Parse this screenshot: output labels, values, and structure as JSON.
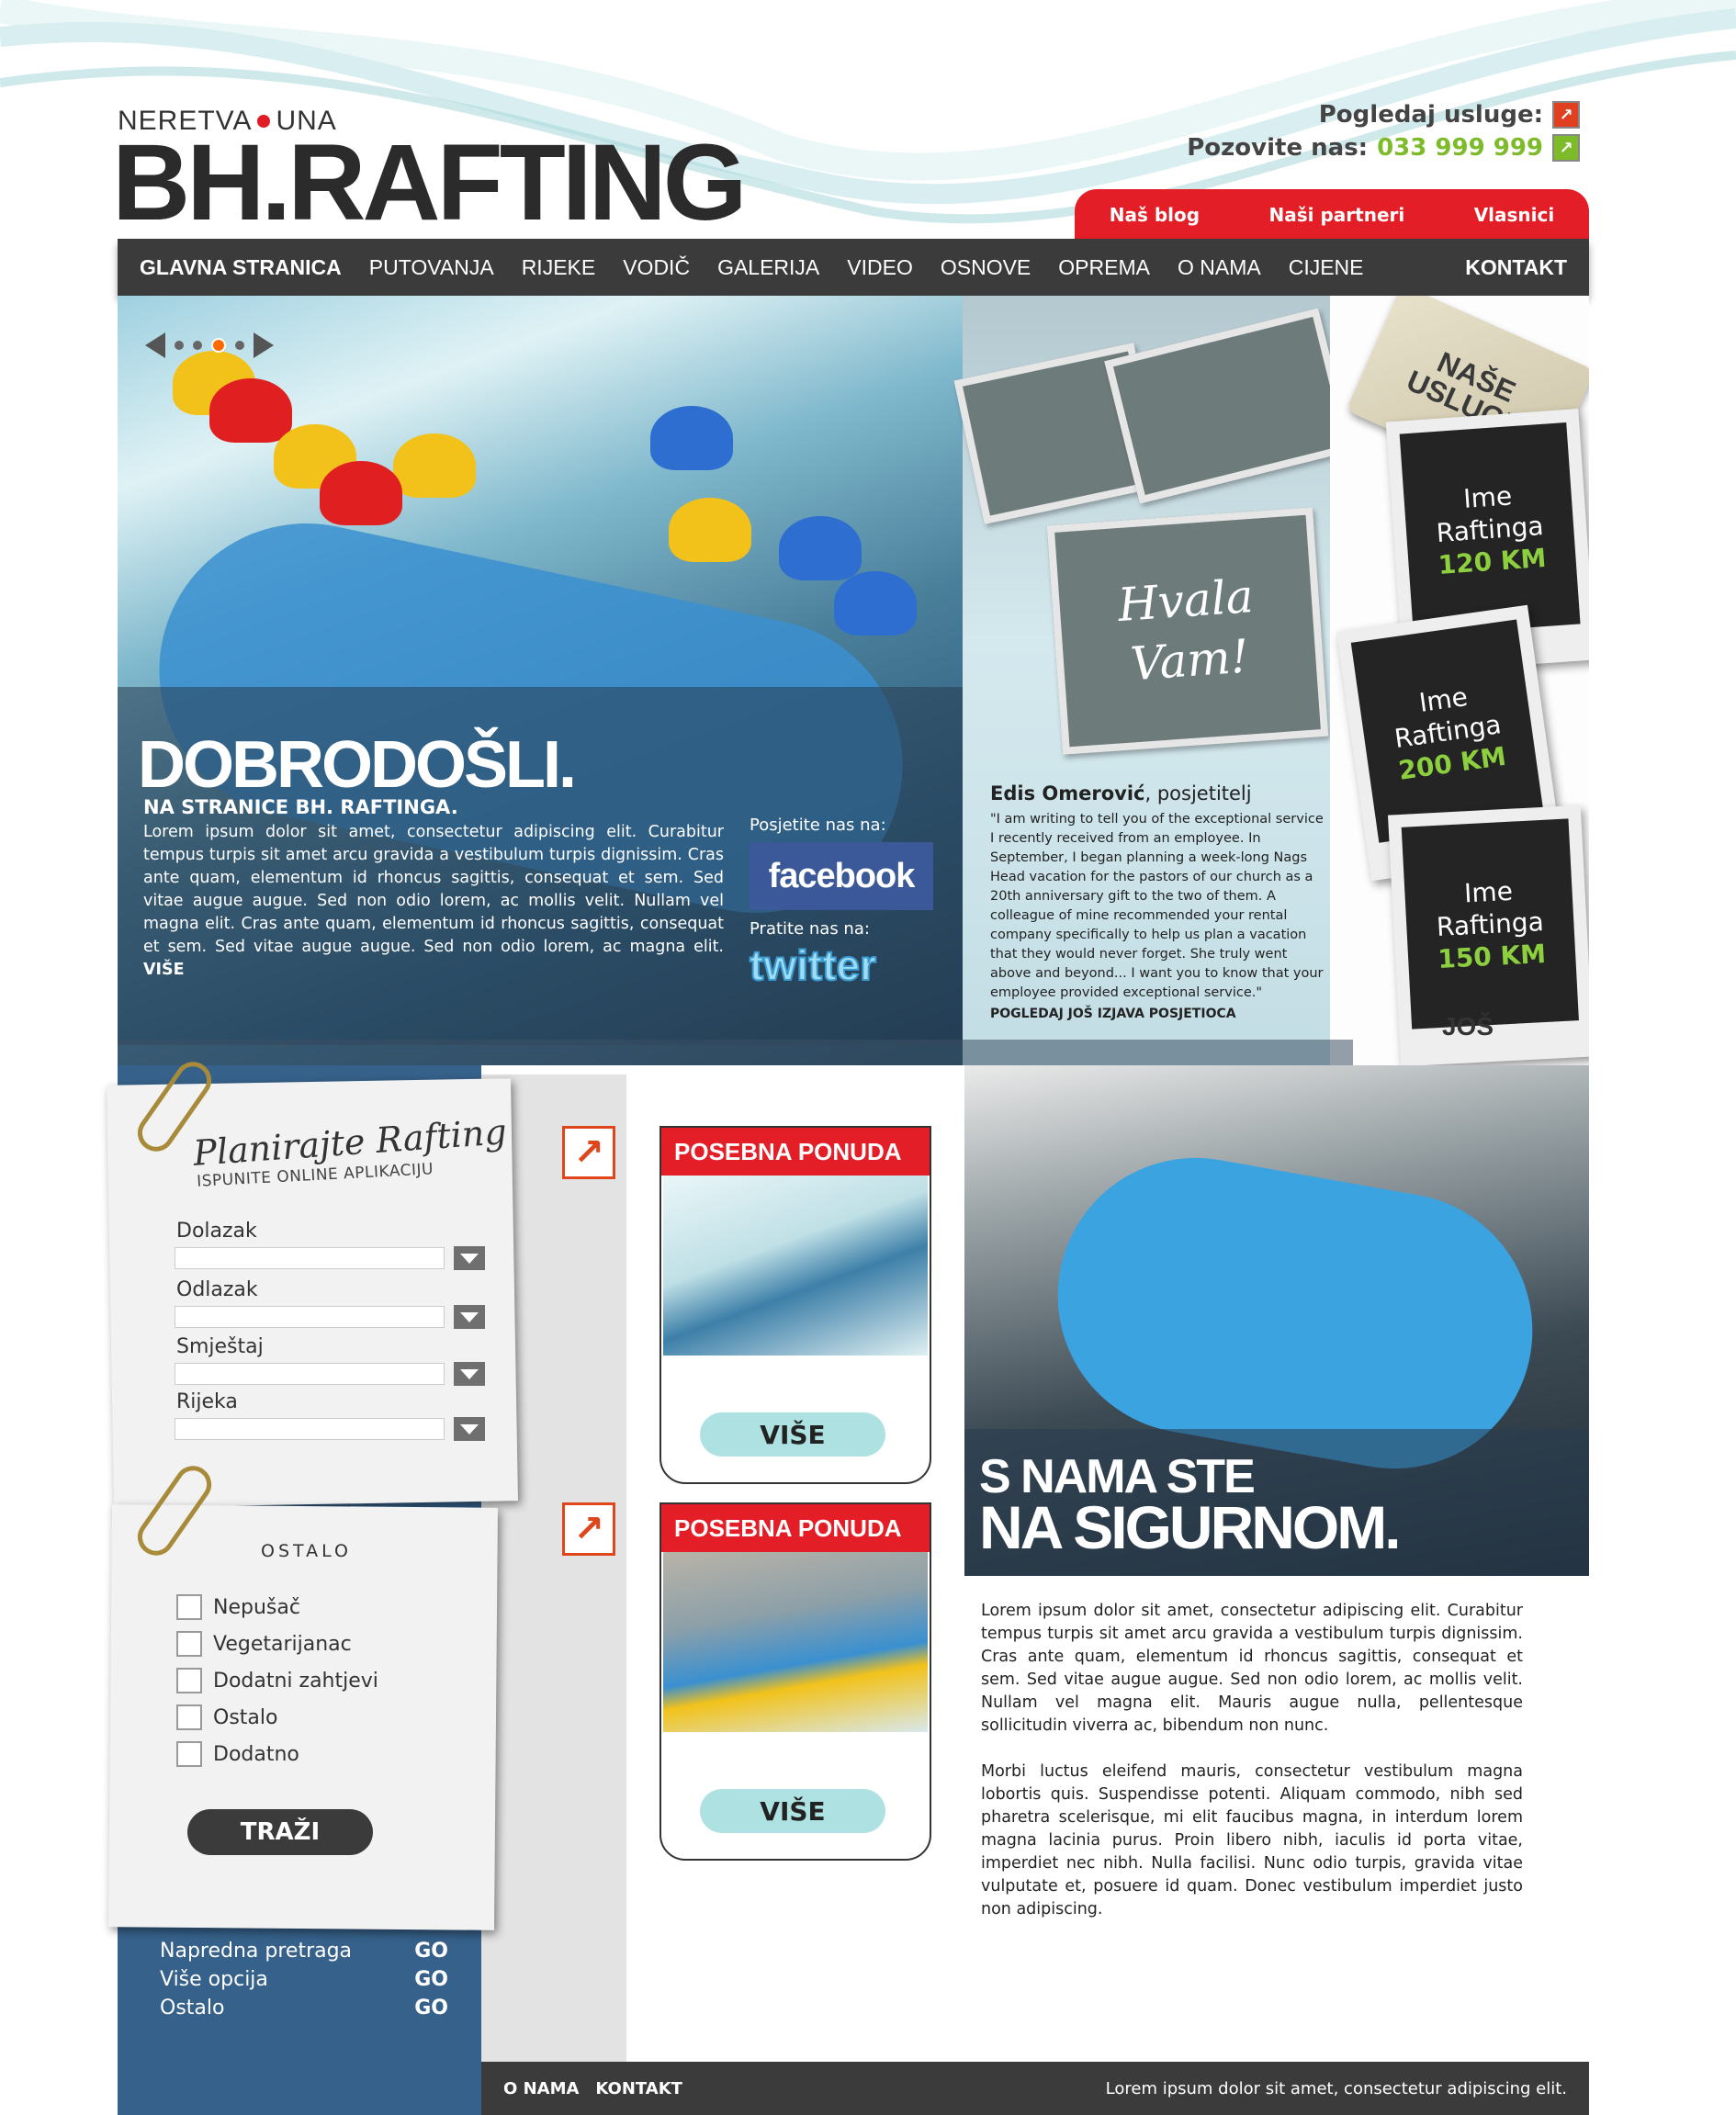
{
  "brand": {
    "top_left": "NERETVA",
    "top_right": "UNA",
    "name": "BH.RAFTING"
  },
  "top_links": {
    "services_label": "Pogledaj usluge:",
    "call_label": "Pozovite nas:",
    "phone": "033 999 999"
  },
  "red_tabs": [
    "Naš blog",
    "Naši partneri",
    "Vlasnici"
  ],
  "nav": {
    "items": [
      "GLAVNA STRANICA",
      "PUTOVANJA",
      "RIJEKE",
      "VODIČ",
      "GALERIJA",
      "VIDEO",
      "OSNOVE",
      "OPREMA",
      "O NAMA",
      "CIJENE"
    ],
    "right": "KONTAKT"
  },
  "hero": {
    "title": "DOBRODOŠLI.",
    "subtitle": "NA STRANICE BH. RAFTINGA.",
    "text": "Lorem ipsum dolor sit amet, consectetur adipiscing elit. Curabitur tempus turpis sit amet arcu gravida a vestibulum turpis dignissim. Cras ante quam, elementum id rhoncus sagittis, consequat et sem. Sed vitae augue augue. Sed non odio lorem, ac mollis velit. Nullam vel magna elit. Cras ante quam, elementum id rhoncus sagittis, consequat et sem. Sed vitae augue augue. Sed non odio lorem, ac magna elit.",
    "more": "VIŠE",
    "visit_label": "Posjetite nas na:",
    "facebook": "facebook",
    "follow_label": "Pratite nas na:",
    "twitter": "twitter"
  },
  "testimonial": {
    "thanks_line1": "Hvala",
    "thanks_line2": "Vam!",
    "name": "Edis Omerović",
    "role": ", posjetitelj",
    "body": "\"I am writing to tell you of the exceptional service I recently received from an employee. In September, I began planning a week-long Nags Head vacation for the pastors of our church as a 20th anniversary gift to the two of them. A colleague of mine recommended your rental company specifically to help us plan a vacation that they would never forget. She truly went above and beyond... I want you to know that your employee provided exceptional service.\"",
    "more": "POGLEDAJ JOŠ IZJAVA POSJETIOCA"
  },
  "services": {
    "tag": "NAŠE USLUGE",
    "cards": [
      {
        "name1": "Ime",
        "name2": "Raftinga",
        "price": "120 KM"
      },
      {
        "name1": "Ime",
        "name2": "Raftinga",
        "price": "200 KM"
      },
      {
        "name1": "Ime",
        "name2": "Raftinga",
        "price": "150 KM"
      }
    ],
    "more": "JOŠ"
  },
  "plan_form": {
    "title": "Planirajte Rafting",
    "subtitle": "ISPUNITE ONLINE APLIKACIJU",
    "fields": [
      "Dolazak",
      "Odlazak",
      "Smještaj",
      "Rijeka"
    ]
  },
  "other_form": {
    "title": "OSTALO",
    "options": [
      "Nepušač",
      "Vegetarijanac",
      "Dodatni zahtjevi",
      "Ostalo",
      "Dodatno"
    ],
    "button": "TRAŽI"
  },
  "left_links": [
    {
      "label": "Napredna pretraga",
      "action": "GO"
    },
    {
      "label": "Više opcija",
      "action": "GO"
    },
    {
      "label": "Ostalo",
      "action": "GO"
    }
  ],
  "offers": [
    {
      "title": "POSEBNA PONUDA",
      "button": "VIŠE"
    },
    {
      "title": "POSEBNA PONUDA",
      "button": "VIŠE"
    }
  ],
  "safety": {
    "line1": "S NAMA STE",
    "line2": "NA SIGURNOM.",
    "para1": "Lorem ipsum dolor sit amet, consectetur adipiscing elit. Curabitur tempus turpis sit amet arcu gravida a vestibulum turpis dignissim. Cras ante quam, elementum id rhoncus sagittis, consequat et sem. Sed vitae augue augue. Sed non odio lorem, ac mollis velit. Nullam vel magna elit. Mauris augue nulla, pellentesque sollicitudin viverra ac, bibendum non nunc.",
    "para2": "Morbi luctus eleifend mauris, consectetur vestibulum magna lobortis quis. Suspendisse potenti. Aliquam commodo, nibh sed pharetra scelerisque, mi elit faucibus magna, in interdum lorem magna lacinia purus. Proin libero nibh, iaculis id porta vitae, imperdiet nec nibh. Nulla facilisi. Nunc odio turpis, gravida vitae vulputate et, posuere id quam. Donec vestibulum imperdiet justo non adipiscing."
  },
  "footer": {
    "links": [
      "O NAMA",
      "KONTAKT"
    ],
    "text": "Lorem ipsum dolor sit amet, consectetur adipiscing elit."
  },
  "colors": {
    "red": "#e41e26",
    "dark": "#3b3b3b",
    "blue": "#36618a",
    "green": "#7dbb2b"
  }
}
